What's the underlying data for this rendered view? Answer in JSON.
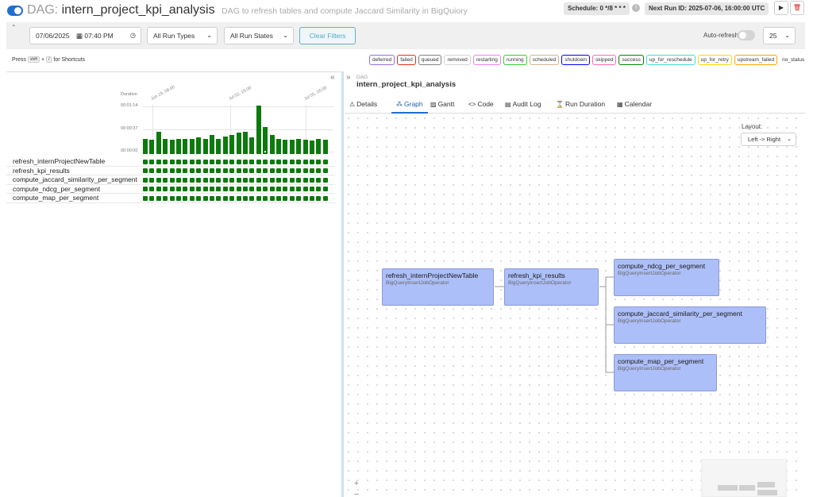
{
  "header": {
    "prefix": "DAG:",
    "dag_id": "intern_project_kpi_analysis",
    "description": "DAG to refresh tables and compute Jaccard Similarity in BigQuiory",
    "schedule": "Schedule: 0 */8 * * *",
    "next_run": "Next Run ID: 2025-07-06, 16:00:00 UTC",
    "info_icon": "i",
    "play_icon": "▶",
    "delete_icon": "🗑"
  },
  "filters": {
    "date": "07/06/2025",
    "time": "07:40 PM",
    "run_types": "All Run Types",
    "run_states": "All Run States",
    "clear_label": "Clear Filters",
    "autorefresh_label": "Auto-refresh",
    "page_size": "25"
  },
  "shortcuts": {
    "press": "Press",
    "key1": "shift",
    "plus": "+",
    "key2": "/",
    "suffix": "for Shortcuts"
  },
  "legend": [
    {
      "label": "deferred",
      "color": "#9370db"
    },
    {
      "label": "failed",
      "color": "#e52b1d"
    },
    {
      "label": "queued",
      "color": "#808080"
    },
    {
      "label": "removed",
      "color": "#d3d3d3"
    },
    {
      "label": "restarting",
      "color": "#ee82ee"
    },
    {
      "label": "running",
      "color": "#32cd32"
    },
    {
      "label": "scheduled",
      "color": "#d2b48c"
    },
    {
      "label": "shutdown",
      "color": "#0000ff"
    },
    {
      "label": "skipped",
      "color": "#ff69b4"
    },
    {
      "label": "success",
      "color": "#008000"
    },
    {
      "label": "up_for_reschedule",
      "color": "#40e0d0"
    },
    {
      "label": "up_for_retry",
      "color": "#ffd700"
    },
    {
      "label": "upstream_failed",
      "color": "#ffa500"
    },
    {
      "label": "no_status",
      "color": ""
    }
  ],
  "chart_data": {
    "type": "bar",
    "ylabel": "Duration",
    "yticks": [
      "00:01:14",
      "00:00:37",
      "00:00:00"
    ],
    "ylim_seconds": [
      0,
      74
    ],
    "xticks": [
      "Jun 29, 08:00",
      "Jul 02, 16:00",
      "Jul 05, 16:00"
    ],
    "values_seconds": [
      24,
      22,
      34,
      24,
      22,
      23,
      23,
      23,
      26,
      24,
      30,
      23,
      27,
      29,
      33,
      35,
      26,
      75,
      42,
      30,
      24,
      22,
      22,
      23,
      22,
      21,
      23,
      22
    ],
    "marked_bar_index": 18
  },
  "tasks": [
    {
      "name": "refresh_internProjectNewTable"
    },
    {
      "name": "refresh_kpi_results"
    },
    {
      "name": "compute_jaccard_similarity_per_segment"
    },
    {
      "name": "compute_ndcg_per_segment"
    },
    {
      "name": "compute_map_per_segment"
    }
  ],
  "breadcrumb": {
    "label": "DAG",
    "name": "intern_project_kpi_analysis"
  },
  "tabs": [
    {
      "label": "Details",
      "icon": "⚠"
    },
    {
      "label": "Graph",
      "icon": "⁂"
    },
    {
      "label": "Gantt",
      "icon": "▨"
    },
    {
      "label": "Code",
      "icon": "<>"
    },
    {
      "label": "Audit Log",
      "icon": "▤"
    },
    {
      "label": "Run Duration",
      "icon": "⌛"
    },
    {
      "label": "Calendar",
      "icon": "▦"
    }
  ],
  "graph": {
    "layout_label": "Layout:",
    "layout_value": "Left -> Right",
    "nodes": [
      {
        "title": "refresh_internProjectNewTable",
        "operator": "BigQueryInsertJobOperator"
      },
      {
        "title": "refresh_kpi_results",
        "operator": "BigQueryInsertJobOperator"
      },
      {
        "title": "compute_ndcg_per_segment",
        "operator": "BigQueryInsertJobOperator"
      },
      {
        "title": "compute_jaccard_similarity_per_segment",
        "operator": "BigQueryInsertJobOperator"
      },
      {
        "title": "compute_map_per_segment",
        "operator": "BigQueryInsertJobOperator"
      }
    ],
    "zoom_in": "+",
    "zoom_out": "−"
  }
}
